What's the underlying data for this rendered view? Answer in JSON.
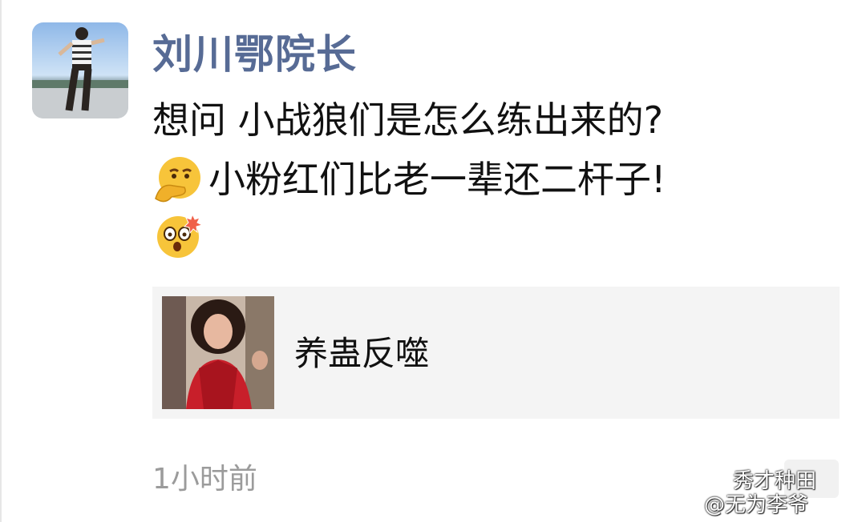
{
  "post": {
    "author": "刘川鄂院长",
    "lines": [
      "想问 小战狼们是怎么练出来的?",
      "小粉红们比老一辈还二杆子!"
    ],
    "emoji_line2": "covering-mouth-emoji",
    "emoji_line3": "shocked-emoji",
    "timestamp": "1小时前"
  },
  "link_card": {
    "title": "养蛊反噬",
    "thumbnail": "woman-in-red-dress-photo"
  },
  "watermark": {
    "line1": "秀才种田",
    "line2": "@无为李爷"
  },
  "colors": {
    "author_name": "#576b95",
    "body_text": "#111111",
    "timestamp": "#9b9b9b",
    "card_bg": "#f4f4f4"
  }
}
